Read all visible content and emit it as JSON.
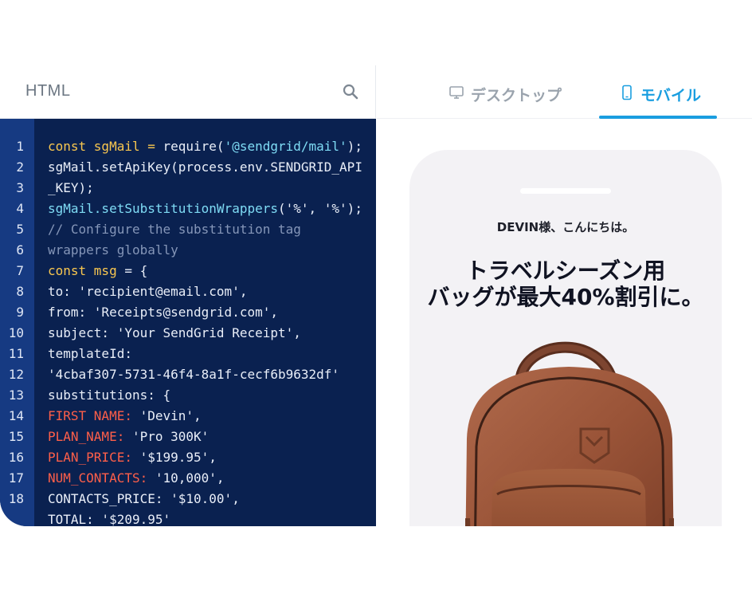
{
  "editor": {
    "title": "HTML",
    "search_icon": "search-icon",
    "lines": [
      {
        "num": "1",
        "tokens": [
          {
            "t": "const sgMail",
            "c": "t-kw"
          },
          {
            "t": " = ",
            "c": "t-kw"
          },
          {
            "t": "require(",
            "c": "t-pl"
          },
          {
            "t": "'@sendgrid/mail'",
            "c": "t-str"
          },
          {
            "t": ");",
            "c": "t-pl"
          }
        ]
      },
      {
        "num": "2",
        "tokens": [
          {
            "t": "sgMail.setApiKey(process.env.SENDGRID_API",
            "c": "t-pl"
          }
        ]
      },
      {
        "num": "3",
        "tokens": [
          {
            "t": "_KEY);",
            "c": "t-pl"
          }
        ]
      },
      {
        "num": "4",
        "tokens": [
          {
            "t": "sgMail.setSubstitutionWrappers",
            "c": "t-fn"
          },
          {
            "t": "('%', '%');",
            "c": "t-pl"
          }
        ]
      },
      {
        "num": "5",
        "tokens": [
          {
            "t": "// Configure the substitution tag",
            "c": "t-cm"
          }
        ]
      },
      {
        "num": "6",
        "tokens": [
          {
            "t": "wrappers globally",
            "c": "t-cm"
          }
        ]
      },
      {
        "num": "7",
        "tokens": [
          {
            "t": "const msg",
            "c": "t-kw"
          },
          {
            "t": " = {",
            "c": "t-pl"
          }
        ]
      },
      {
        "num": "8",
        "tokens": [
          {
            "t": "to: 'recipient@email.com',",
            "c": "t-pl"
          }
        ]
      },
      {
        "num": "9",
        "tokens": [
          {
            "t": "from: 'Receipts@sendgrid.com',",
            "c": "t-pl"
          }
        ]
      },
      {
        "num": "10",
        "tokens": [
          {
            "t": "subject: 'Your SendGrid Receipt',",
            "c": "t-pl"
          }
        ]
      },
      {
        "num": "11",
        "tokens": [
          {
            "t": "templateId:",
            "c": "t-pl"
          }
        ]
      },
      {
        "num": "12",
        "tokens": [
          {
            "t": "'4cbaf307-5731-46f4-8a1f-cecf6b9632df'",
            "c": "t-pl"
          }
        ]
      },
      {
        "num": "13",
        "tokens": [
          {
            "t": "substitutions: {",
            "c": "t-pl"
          }
        ]
      },
      {
        "num": "14",
        "tokens": [
          {
            "t": "FIRST NAME:",
            "c": "t-key"
          },
          {
            "t": " 'Devin',",
            "c": "t-pl"
          }
        ]
      },
      {
        "num": "15",
        "tokens": [
          {
            "t": "PLAN_NAME:",
            "c": "t-key"
          },
          {
            "t": " 'Pro 300K'",
            "c": "t-pl"
          }
        ]
      },
      {
        "num": "16",
        "tokens": [
          {
            "t": "PLAN_PRICE:",
            "c": "t-key"
          },
          {
            "t": " '$199.95',",
            "c": "t-pl"
          }
        ]
      },
      {
        "num": "17",
        "tokens": [
          {
            "t": "NUM_CONTACTS:",
            "c": "t-key"
          },
          {
            "t": " '10,000',",
            "c": "t-pl"
          }
        ]
      },
      {
        "num": "18",
        "tokens": [
          {
            "t": "CONTACTS_PRICE: '$10.00',",
            "c": "t-pl"
          }
        ]
      },
      {
        "num": "",
        "tokens": [
          {
            "t": "TOTAL: '$209.95'",
            "c": "t-pl"
          }
        ]
      }
    ]
  },
  "preview": {
    "tabs": [
      {
        "label": "デスクトップ",
        "icon": "monitor-icon",
        "active": false
      },
      {
        "label": "モバイル",
        "icon": "smartphone-icon",
        "active": true
      }
    ],
    "greeting": "DEVIN様、こんにちは。",
    "headline_line1": "トラベルシーズン用",
    "headline_line2": "バッグが最大40%割引に。"
  },
  "colors": {
    "code_bg": "#0a2150",
    "gutter_bg": "#163a82",
    "accent": "#1a9ee0",
    "keyword": "#f9c74f",
    "string": "#7fdcf5",
    "comment": "#8596b8",
    "key": "#ff5f49"
  }
}
